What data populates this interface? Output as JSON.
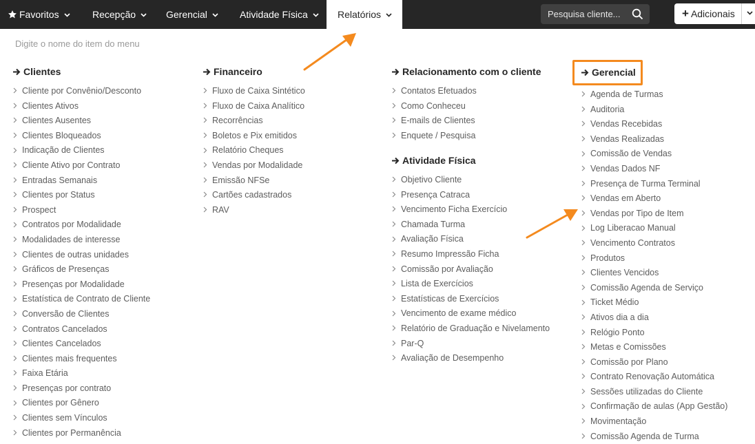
{
  "nav": {
    "favoritos": "Favoritos",
    "recepcao": "Recepção",
    "gerencial": "Gerencial",
    "atividade_fisica": "Atividade Física",
    "relatorios": "Relatórios",
    "search_placeholder": "Pesquisa cliente...",
    "add_label": "Adicionais"
  },
  "menu_filter": {
    "placeholder": "Digite o nome do item do menu"
  },
  "columns": {
    "clientes": {
      "title": "Clientes",
      "items": [
        "Cliente por Convênio/Desconto",
        "Clientes Ativos",
        "Clientes Ausentes",
        "Clientes Bloqueados",
        "Indicação de Clientes",
        "Cliente Ativo por Contrato",
        "Entradas Semanais",
        "Clientes por Status",
        "Prospect",
        "Contratos por Modalidade",
        "Modalidades de interesse",
        "Clientes de outras unidades",
        "Gráficos de Presenças",
        "Presenças por Modalidade",
        "Estatística de Contrato de Cliente",
        "Conversão de Clientes",
        "Contratos Cancelados",
        "Clientes Cancelados",
        "Clientes mais frequentes",
        "Faixa Etária",
        "Presenças por contrato",
        "Clientes por Gênero",
        "Clientes sem Vínculos",
        "Clientes por Permanência"
      ]
    },
    "financeiro": {
      "title": "Financeiro",
      "items": [
        "Fluxo de Caixa Sintético",
        "Fluxo de Caixa Analítico",
        "Recorrências",
        "Boletos e Pix emitidos",
        "Relatório Cheques",
        "Vendas por Modalidade",
        "Emissão NFSe",
        "Cartões cadastrados",
        "RAV"
      ]
    },
    "relacionamento": {
      "title": "Relacionamento com o cliente",
      "items": [
        "Contatos Efetuados",
        "Como Conheceu",
        "E-mails de Clientes",
        "Enquete / Pesquisa"
      ]
    },
    "atividade": {
      "title": "Atividade Física",
      "items": [
        "Objetivo Cliente",
        "Presença Catraca",
        "Vencimento Ficha Exercício",
        "Chamada Turma",
        "Avaliação Física",
        "Resumo Impressão Ficha",
        "Comissão por Avaliação",
        "Lista de Exercícios",
        "Estatísticas de Exercícios",
        "Vencimento de exame médico",
        "Relatório de Graduação e Nivelamento",
        "Par-Q",
        "Avaliação de Desempenho"
      ]
    },
    "gerencial": {
      "title": "Gerencial",
      "items": [
        "Agenda de Turmas",
        "Auditoria",
        "Vendas Recebidas",
        "Vendas Realizadas",
        "Comissão de Vendas",
        "Vendas Dados NF",
        "Presença de Turma Terminal",
        "Vendas em Aberto",
        "Vendas por Tipo de Item",
        "Log Liberacao Manual",
        "Vencimento Contratos",
        "Produtos",
        "Clientes Vencidos",
        "Comissão Agenda de Serviço",
        "Ticket Médio",
        "Ativos dia a dia",
        "Relógio Ponto",
        "Metas e Comissões",
        "Comissão por Plano",
        "Contrato Renovação Automática",
        "Sessões utilizadas do Cliente",
        "Confirmação de aulas (App Gestão)",
        "Movimentação",
        "Comissão Agenda de Turma"
      ]
    }
  },
  "colors": {
    "navbar": "#262626",
    "highlight": "#f48a1e",
    "item_text": "#5d5d5d"
  },
  "icons": {
    "favoritos": "star-icon",
    "nav_chevron": "chevron-down-icon",
    "search": "search-icon",
    "add": "plus-icon",
    "heading": "arrow-right-icon",
    "item": "chevron-right-icon",
    "annotation": "orange-arrow-annotation"
  }
}
